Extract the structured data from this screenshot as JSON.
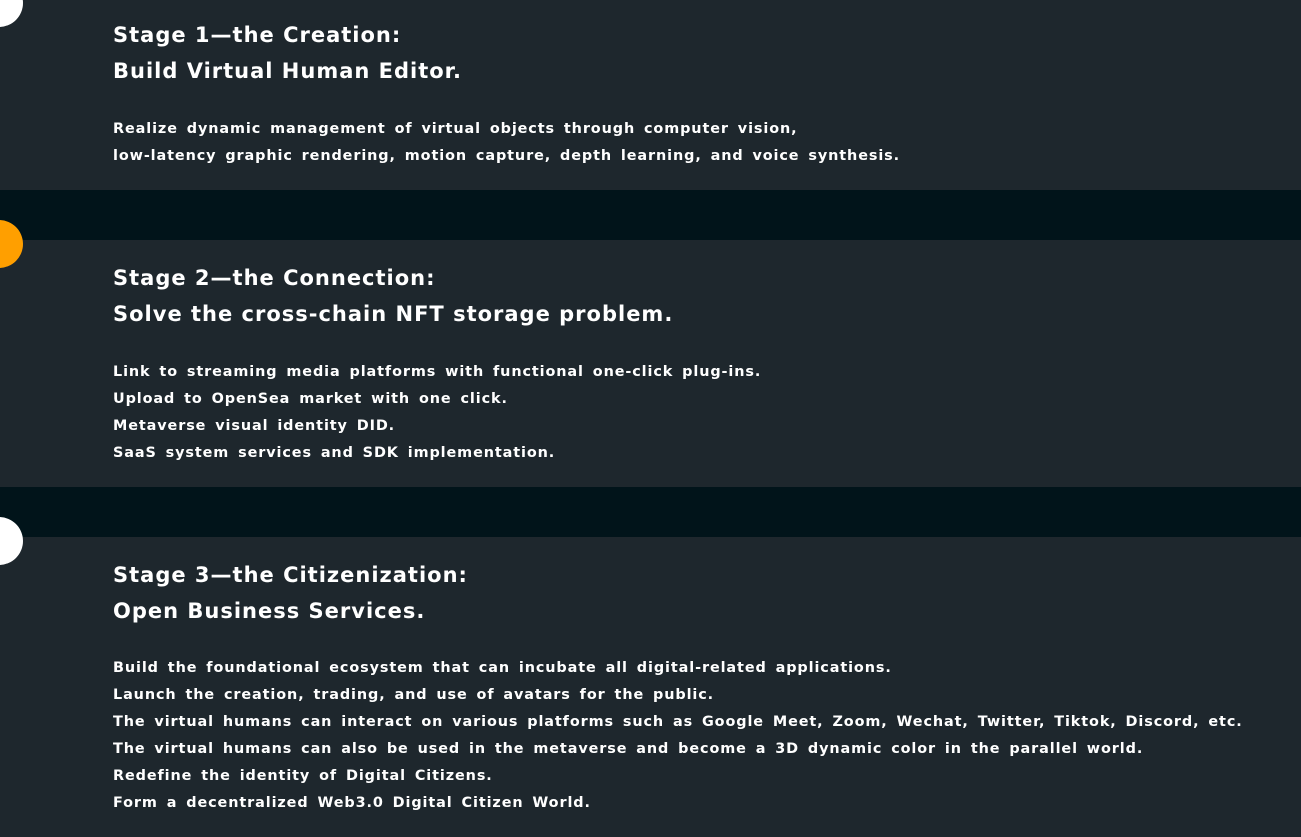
{
  "colors": {
    "page_background": "#01141a",
    "panel_background": "#1e272d",
    "text": "#ffffff",
    "stage_1_marker": "#ffffff",
    "stage_2_marker": "#ff9f00",
    "stage_3_marker": "#ffffff"
  },
  "stages": [
    {
      "title": "Stage 1—the Creation:",
      "subtitle": "Build Virtual Human Editor.",
      "lines": [
        "Realize dynamic management of virtual objects through computer vision,",
        "low-latency graphic rendering, motion capture, depth learning, and voice synthesis."
      ]
    },
    {
      "title": "Stage 2—the Connection:",
      "subtitle": "Solve the cross-chain NFT storage problem.",
      "lines": [
        "Link to streaming media platforms with functional one-click plug-ins.",
        "Upload to OpenSea market with one click.",
        "Metaverse visual identity DID.",
        "SaaS system services and SDK implementation."
      ]
    },
    {
      "title": "Stage 3—the Citizenization:",
      "subtitle": "Open Business Services.",
      "lines": [
        "Build the foundational ecosystem that can incubate all digital-related applications.",
        "Launch the creation, trading, and use of avatars for the public.",
        "The virtual humans can interact on various platforms such as Google Meet, Zoom, Wechat, Twitter, Tiktok, Discord, etc.",
        "The virtual humans can also be used in the metaverse and become a 3D dynamic color in the parallel world.",
        "Redefine the identity of Digital Citizens.",
        "Form a decentralized Web3.0 Digital Citizen World."
      ]
    }
  ]
}
